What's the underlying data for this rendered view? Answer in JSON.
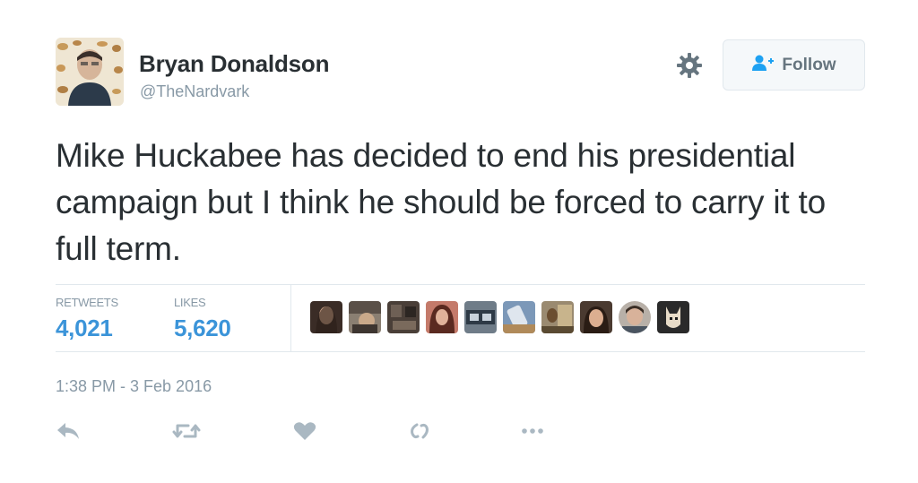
{
  "user": {
    "display_name": "Bryan Donaldson",
    "handle": "@TheNardvark"
  },
  "header": {
    "follow_label": "Follow"
  },
  "tweet": {
    "text": "Mike Huckabee has decided to end his presidential campaign but I think he should be forced to carry it to full term.",
    "timestamp": "1:38 PM - 3 Feb 2016"
  },
  "stats": {
    "retweets_label": "RETWEETS",
    "retweets_count": "4,021",
    "likes_label": "LIKES",
    "likes_count": "5,620"
  },
  "colors": {
    "link": "#3b94d9",
    "muted": "#8899a6",
    "text": "#292f33",
    "border": "#e1e8ed"
  },
  "icons": {
    "settings": "gear-icon",
    "follow": "add-user-icon",
    "reply": "reply-icon",
    "retweet": "retweet-icon",
    "like": "heart-icon",
    "vine": "vine-icon",
    "more": "more-icon"
  }
}
